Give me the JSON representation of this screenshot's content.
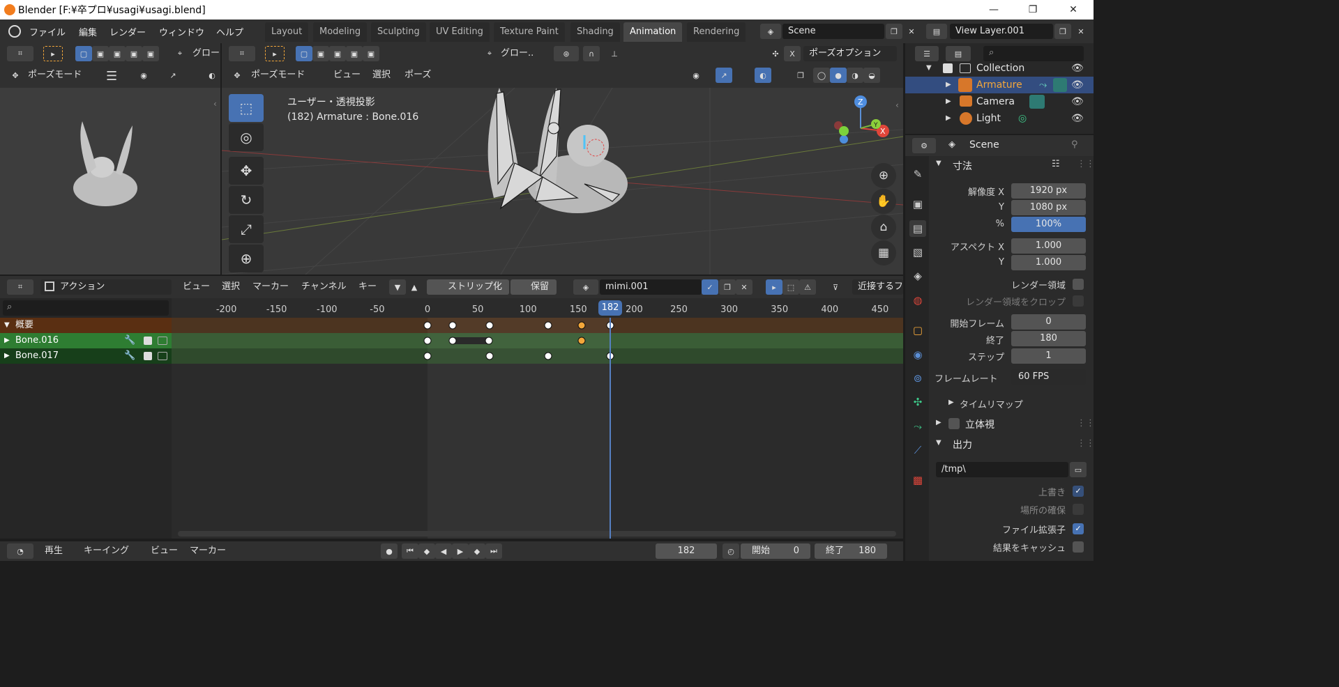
{
  "window": {
    "title": "Blender [F:¥卒プロ¥usagi¥usagi.blend]",
    "min": "—",
    "max": "❐",
    "close": "✕"
  },
  "menu": {
    "items": [
      "ファイル",
      "編集",
      "レンダー",
      "ウィンドウ",
      "ヘルプ"
    ]
  },
  "workspaces": [
    "Layout",
    "Modeling",
    "Sculpting",
    "UV Editing",
    "Texture Paint",
    "Shading",
    "Animation",
    "Rendering"
  ],
  "active_workspace": "Animation",
  "scene": {
    "name": "Scene",
    "view_layer": "View Layer.001"
  },
  "left_view": {
    "mode": "ポーズモード",
    "global": "グロー"
  },
  "viewport": {
    "mode": "ポーズモード",
    "menus": [
      "ビュー",
      "選択",
      "ポーズ"
    ],
    "transform": "グロー..",
    "pose_options": "ポーズオプション",
    "x_label": "X",
    "overlay_line1": "ユーザー・透視投影",
    "overlay_line2": "(182) Armature : Bone.016",
    "gizmo": {
      "z": "Z",
      "y": "Y",
      "x": "X"
    }
  },
  "dopesheet": {
    "mode": "アクション",
    "menus": [
      "ビュー",
      "選択",
      "マーカー",
      "チャンネル",
      "キー"
    ],
    "push_down": "ストリップ化",
    "stash": "保留",
    "action_name": "mimi.001",
    "snap": "近接するフ",
    "ruler": [
      "-200",
      "-150",
      "-100",
      "-50",
      "0",
      "50",
      "100",
      "150",
      "200",
      "250",
      "300",
      "350",
      "400",
      "450"
    ],
    "current_frame": "182",
    "channels": [
      {
        "name": "概要",
        "keys": [
          0,
          25,
          62,
          120,
          153,
          182
        ],
        "orange": [
          153
        ]
      },
      {
        "name": "Bone.016",
        "keys": [
          0,
          25,
          61,
          153
        ],
        "orange": [
          153
        ]
      },
      {
        "name": "Bone.017",
        "keys": [
          0,
          62,
          120,
          182
        ],
        "orange": []
      }
    ]
  },
  "timeline": {
    "menus": [
      "再生",
      "キーイング",
      "ビュー",
      "マーカー"
    ],
    "frame": "182",
    "start_label": "開始",
    "start": "0",
    "end_label": "終了",
    "end": "180"
  },
  "outliner": {
    "items": [
      {
        "name": "Collection"
      },
      {
        "name": "Armature"
      },
      {
        "name": "Camera"
      },
      {
        "name": "Light"
      }
    ]
  },
  "properties": {
    "context": "Scene",
    "section_dimensions": "寸法",
    "res_x_label": "解像度 X",
    "res_x": "1920 px",
    "res_y_label": "Y",
    "res_y": "1080 px",
    "pct_label": "%",
    "pct": "100%",
    "aspect_x_label": "アスペクト X",
    "aspect_x": "1.000",
    "aspect_y_label": "Y",
    "aspect_y": "1.000",
    "render_region": "レンダー領域",
    "crop_region": "レンダー領域をクロップ",
    "frame_start_label": "開始フレーム",
    "frame_start": "0",
    "frame_end_label": "終了",
    "frame_end": "180",
    "frame_step_label": "ステップ",
    "frame_step": "1",
    "fps_label": "フレームレート",
    "fps": "60 FPS",
    "time_remap": "タイムリマップ",
    "stereoscopy": "立体視",
    "section_output": "出力",
    "output_path": "/tmp\\",
    "overwrite": "上書き",
    "placeholders": "場所の確保",
    "file_ext": "ファイル拡張子",
    "cache_result": "結果をキャッシュ"
  },
  "colors": {
    "accent": "#4772b3",
    "orange": "#f4a73a",
    "channel_green": "#2e7d32",
    "summary_brown": "#5a2f12"
  }
}
